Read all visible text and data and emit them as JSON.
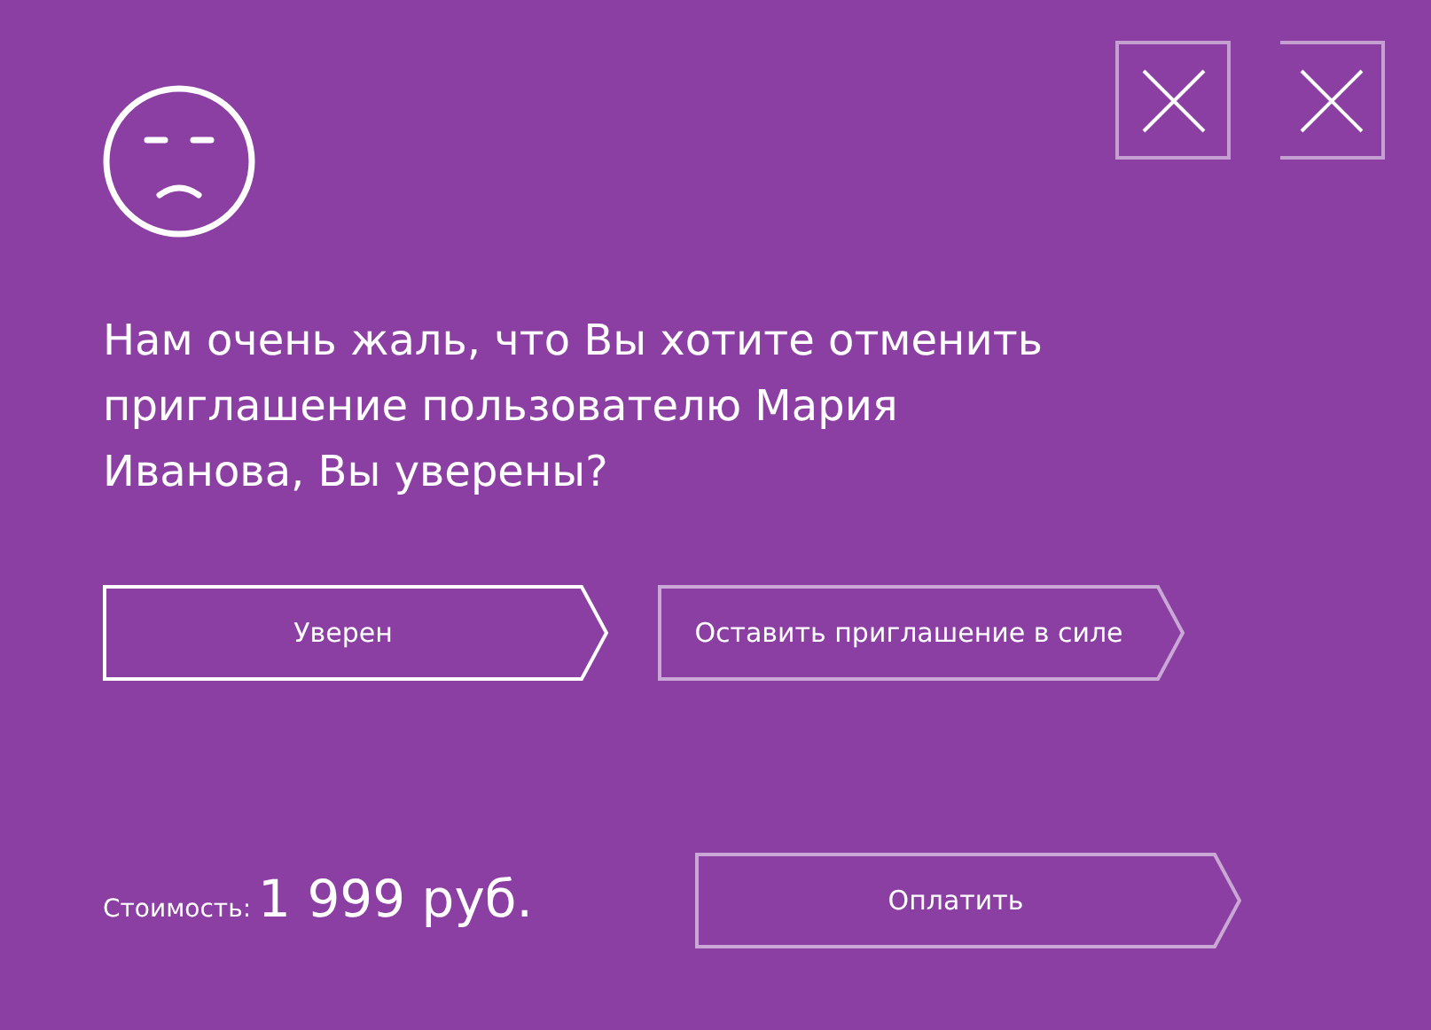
{
  "close_buttons": [
    {
      "left_border": true
    },
    {
      "left_border": false
    }
  ],
  "message": "Нам очень жаль, что Вы хотите отменить приглашение пользователю Мария Иванова, Вы уверены?",
  "actions": [
    {
      "label": "Уверен",
      "kind": "primary"
    },
    {
      "label": "Оставить приглашение в силе",
      "kind": "secondary"
    }
  ],
  "price": {
    "label": "Стоимость:",
    "value": "1 999 руб."
  },
  "pay_button": {
    "label": "Оплатить",
    "kind": "secondary"
  }
}
